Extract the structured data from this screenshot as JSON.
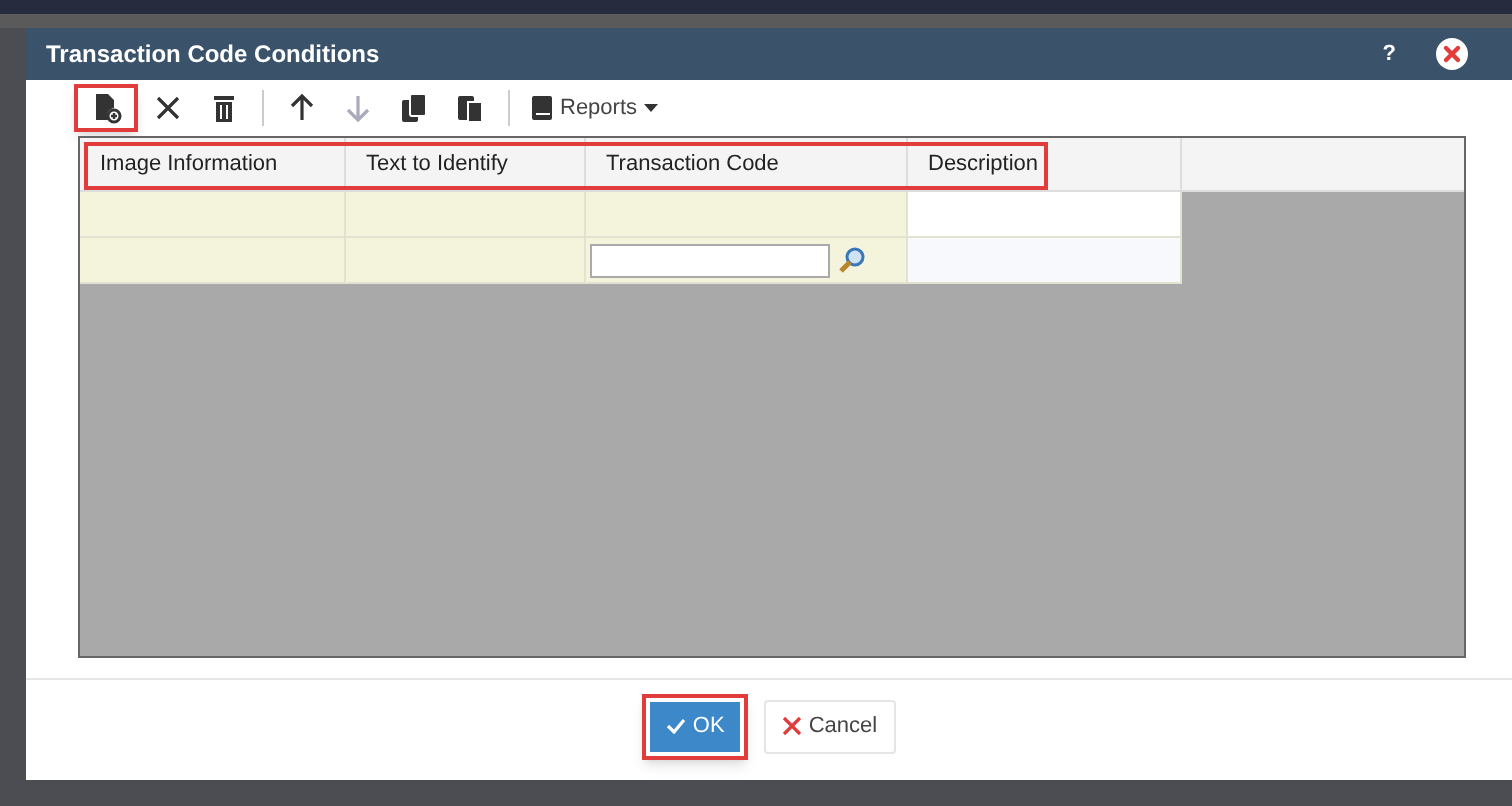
{
  "window": {
    "title": "Transaction Code Conditions",
    "help": "?"
  },
  "toolbar": [
    {
      "kind": "add",
      "disabled": false,
      "highlighted": true
    },
    {
      "kind": "remove",
      "disabled": false,
      "highlighted": false
    },
    {
      "kind": "trash",
      "disabled": false,
      "highlighted": false
    },
    {
      "kind": "separator"
    },
    {
      "kind": "up",
      "disabled": false,
      "highlighted": false
    },
    {
      "kind": "down",
      "disabled": true,
      "highlighted": false
    },
    {
      "kind": "copy",
      "disabled": false,
      "highlighted": false
    },
    {
      "kind": "paste",
      "disabled": false,
      "highlighted": false
    },
    {
      "kind": "separator"
    },
    {
      "kind": "reports",
      "label": "Reports",
      "disabled": false,
      "highlighted": false
    }
  ],
  "table": {
    "header_highlighted": true,
    "columns": [
      "Image Information",
      "Text to Identify",
      "Transaction Code",
      "Description"
    ],
    "rows": [
      {
        "editing": false
      },
      {
        "editing": true
      }
    ]
  },
  "buttons": [
    {
      "kind": "ok",
      "label": "OK",
      "highlighted": true
    },
    {
      "kind": "cancel",
      "label": "Cancel",
      "highlighted": false
    }
  ]
}
